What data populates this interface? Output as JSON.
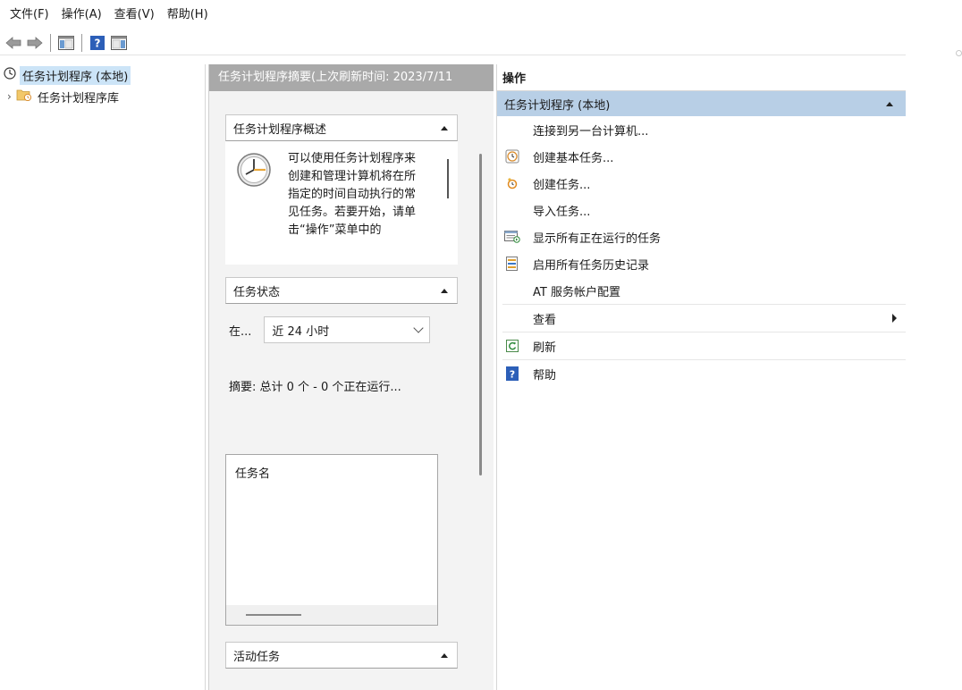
{
  "menubar": {
    "items": [
      "文件(F)",
      "操作(A)",
      "查看(V)",
      "帮助(H)"
    ]
  },
  "toolbar": {
    "icons": [
      "back-arrow-icon",
      "forward-arrow-icon",
      "show-hide-console-tree-icon",
      "help-icon",
      "show-hide-action-pane-icon"
    ]
  },
  "tree": {
    "root_label": "任务计划程序 (本地)",
    "child_label": "任务计划程序库"
  },
  "middle": {
    "header": "任务计划程序摘要(上次刷新时间: 2023/7/11",
    "overview": {
      "title": "任务计划程序概述",
      "text": "可以使用任务计划程序来创建和管理计算机将在所指定的时间自动执行的常见任务。若要开始，请单击“操作”菜单中的"
    },
    "status": {
      "title": "任务状态",
      "label": "在...",
      "select_value": "近 24 小时",
      "summary": "摘要: 总计 0 个 - 0 个正在运行...",
      "task_name_header": "任务名"
    },
    "active": {
      "title": "活动任务"
    }
  },
  "actions": {
    "header": "操作",
    "group": "任务计划程序 (本地)",
    "items": [
      {
        "label": "连接到另一台计算机...",
        "icon": ""
      },
      {
        "label": "创建基本任务...",
        "icon": "basic-task-icon"
      },
      {
        "label": "创建任务...",
        "icon": "create-task-icon"
      },
      {
        "label": "导入任务...",
        "icon": ""
      },
      {
        "label": "显示所有正在运行的任务",
        "icon": "running-tasks-icon"
      },
      {
        "label": "启用所有任务历史记录",
        "icon": "history-icon"
      },
      {
        "label": "AT 服务帐户配置",
        "icon": ""
      },
      {
        "label": "查看",
        "icon": ""
      },
      {
        "label": "刷新",
        "icon": "refresh-icon"
      },
      {
        "label": "帮助",
        "icon": "help-icon"
      }
    ]
  },
  "colors": {
    "selection": "#cce4f7",
    "group_header": "#b8cfe6",
    "middle_header": "#a9a9a9",
    "help_blue": "#2c5fb8"
  }
}
